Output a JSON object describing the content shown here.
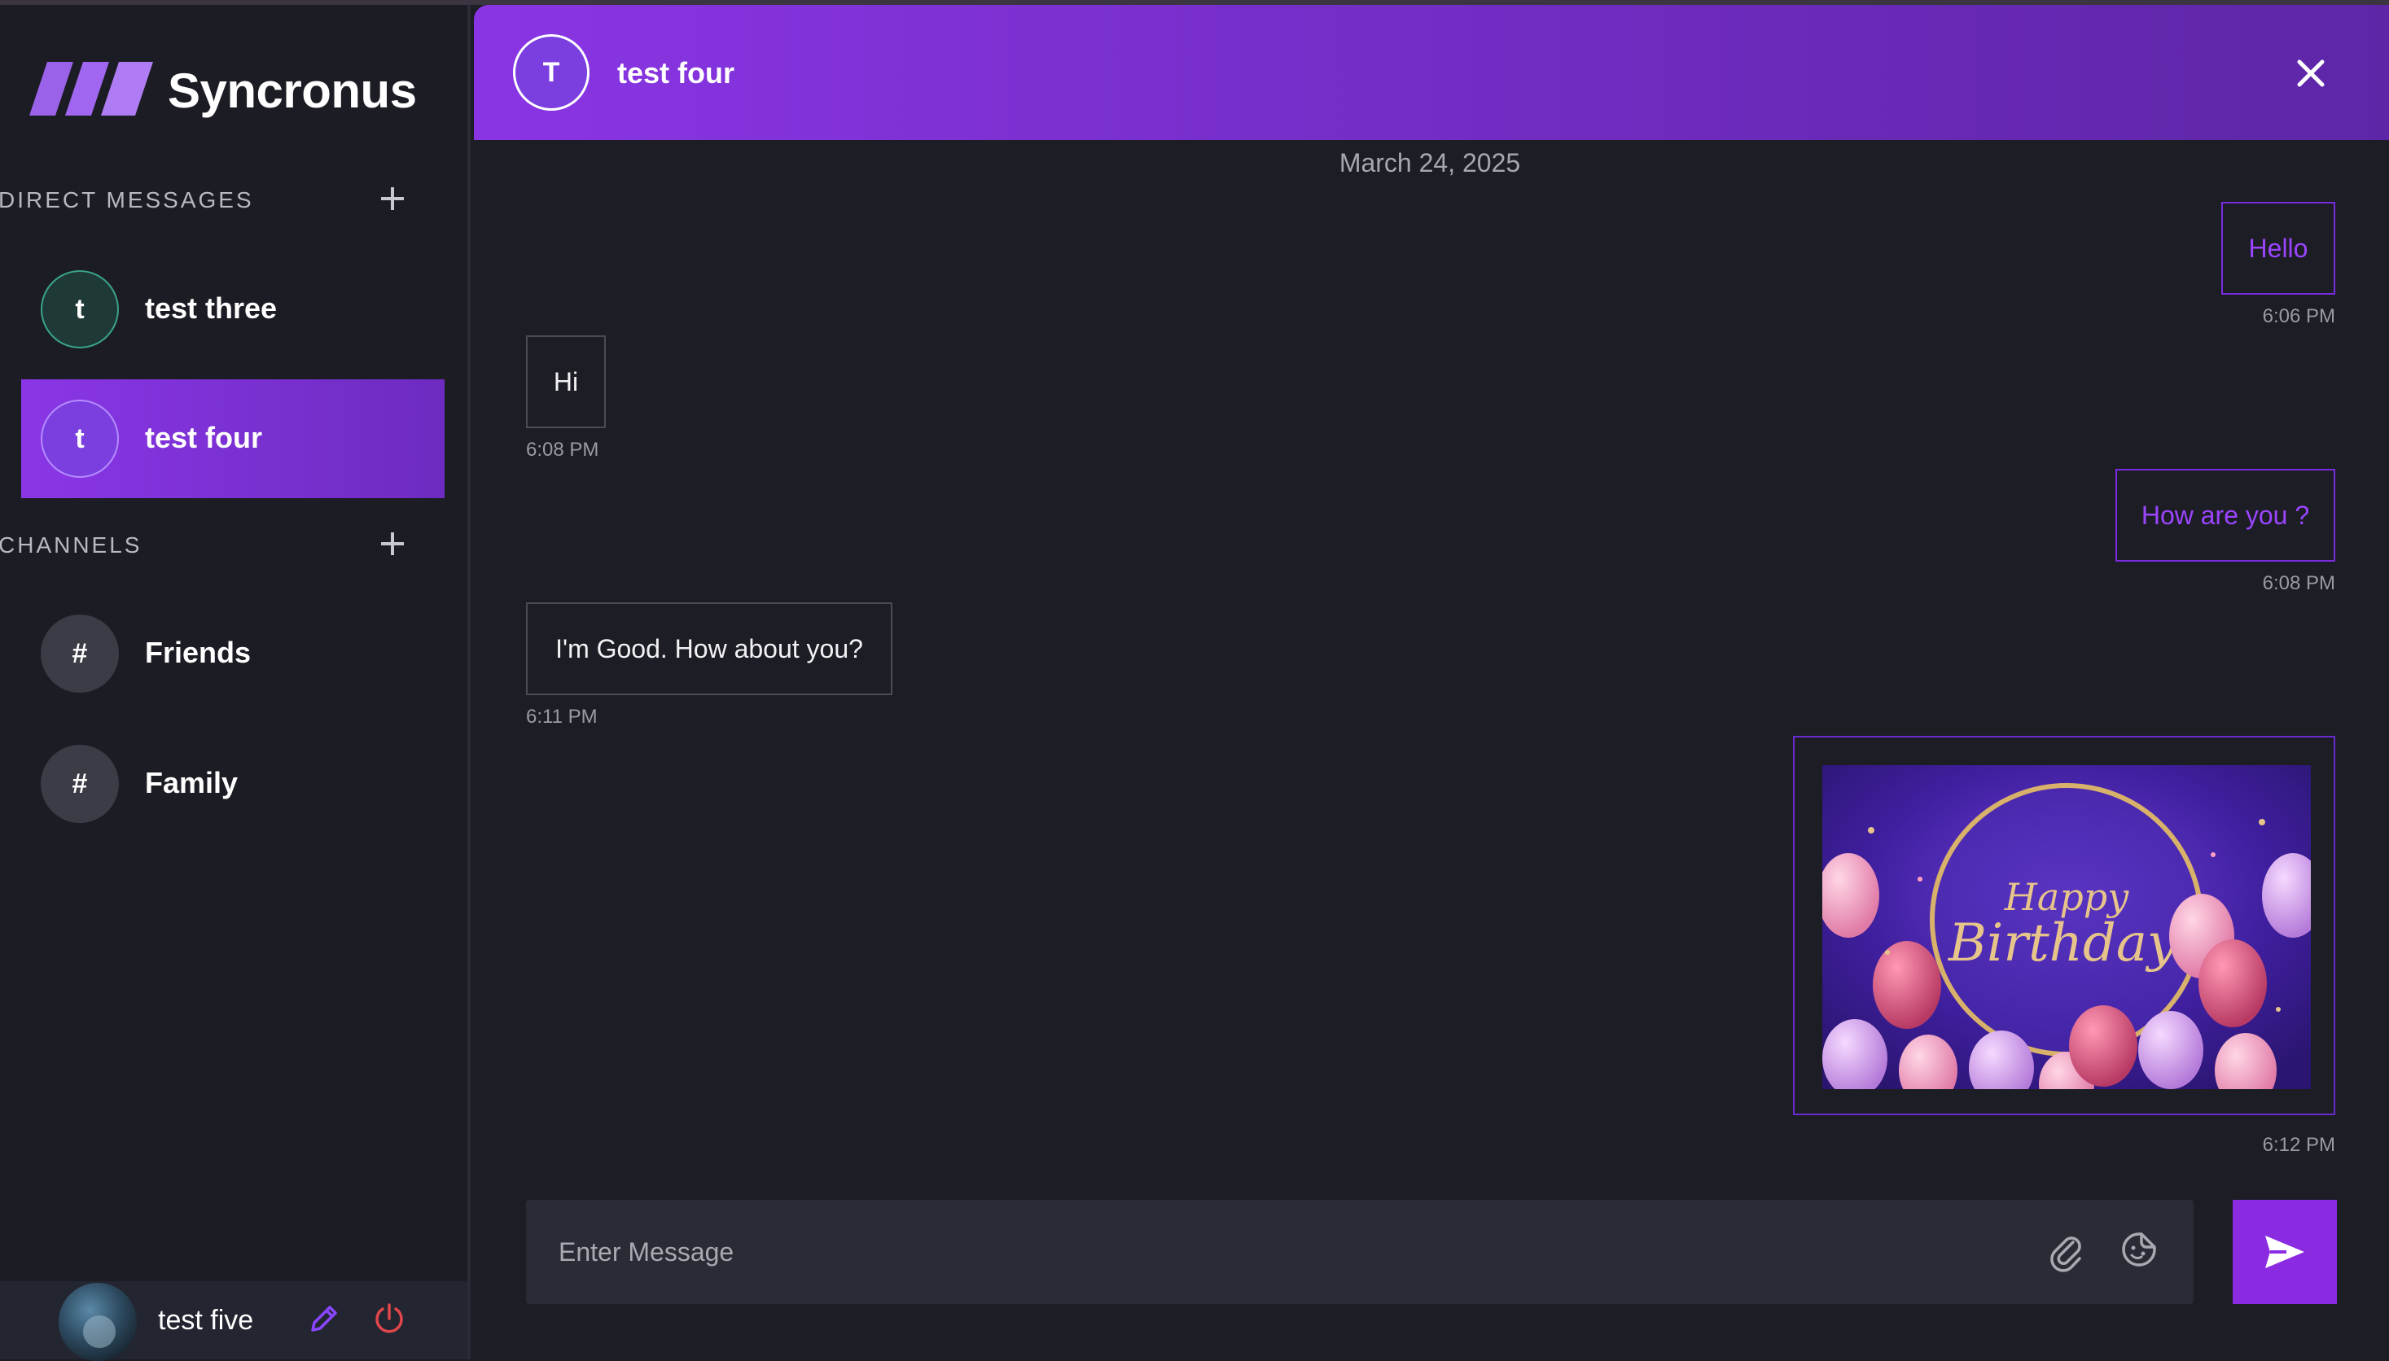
{
  "app": {
    "name": "Syncronus"
  },
  "sidebar": {
    "direct_messages": {
      "title": "DIRECT MESSAGES",
      "items": [
        {
          "initial": "t",
          "name": "test three",
          "active": false,
          "avatar_color": "#1f3a36",
          "avatar_border": "#3aa38a",
          "initial_color": "#ffffff"
        },
        {
          "initial": "t",
          "name": "test four",
          "active": true,
          "avatar_color": "#7b3fe0",
          "avatar_border": "#b48cff",
          "initial_color": "#ffffff"
        }
      ]
    },
    "channels": {
      "title": "CHANNELS",
      "items": [
        {
          "icon": "#",
          "name": "Friends"
        },
        {
          "icon": "#",
          "name": "Family"
        }
      ]
    },
    "user": {
      "name": "test five"
    }
  },
  "chat": {
    "header": {
      "initial": "T",
      "name": "test four"
    },
    "date_separator": "March 24, 2025",
    "messages": [
      {
        "direction": "sent",
        "text": "Hello",
        "time": "6:06 PM"
      },
      {
        "direction": "received",
        "text": "Hi",
        "time": "6:08 PM"
      },
      {
        "direction": "sent",
        "text": "How are you ?",
        "time": "6:08 PM"
      },
      {
        "direction": "received",
        "text": "I'm Good. How about you?",
        "time": "6:11 PM"
      },
      {
        "direction": "sent",
        "type": "image",
        "image_text": [
          "Happy",
          "Birthday"
        ],
        "time": "6:12 PM"
      }
    ],
    "input": {
      "placeholder": "Enter Message",
      "value": ""
    }
  },
  "colors": {
    "accent": "#8a2be2",
    "background": "#1c1d25",
    "sidebar": "#1b1c24",
    "input": "#2a2b35"
  },
  "icons": [
    "logo-mark",
    "plus-icon",
    "close-icon",
    "pencil-icon",
    "power-icon",
    "paperclip-icon",
    "sticker-icon",
    "send-icon"
  ]
}
